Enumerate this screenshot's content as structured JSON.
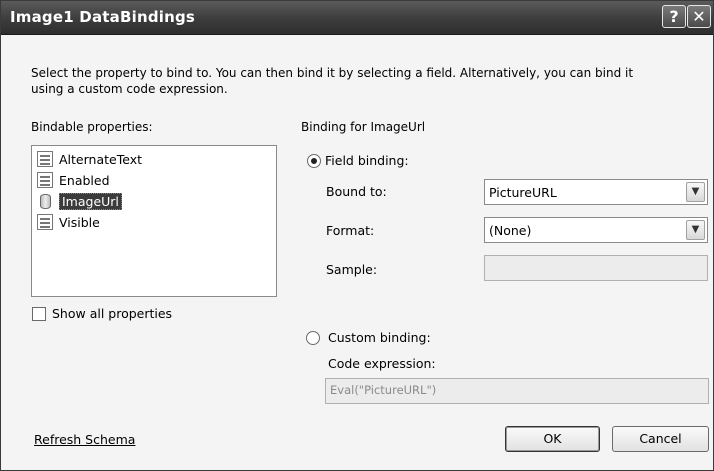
{
  "window": {
    "title": "Image1 DataBindings",
    "help_label": "?",
    "close_label": "✕"
  },
  "description": {
    "line1": "Select the property to bind to. You can then bind it by selecting a field. Alternatively, you can bind it",
    "line2": "using a custom code expression."
  },
  "bindable": {
    "label": "Bindable properties:",
    "items": [
      {
        "label": "AlternateText",
        "icon": "property-icon"
      },
      {
        "label": "Enabled",
        "icon": "property-icon"
      },
      {
        "label": "ImageUrl",
        "icon": "database-icon",
        "selected": true
      },
      {
        "label": "Visible",
        "icon": "property-icon"
      }
    ],
    "show_all_label": "Show all properties",
    "show_all_checked": false
  },
  "binding": {
    "header": "Binding for ImageUrl",
    "field_binding_label": "Field binding:",
    "field_binding_selected": true,
    "bound_to_label": "Bound to:",
    "bound_to_value": "PictureURL",
    "format_label": "Format:",
    "format_value": "(None)",
    "sample_label": "Sample:",
    "sample_value": "",
    "custom_binding_label": "Custom binding:",
    "custom_binding_selected": false,
    "code_expression_label": "Code expression:",
    "code_expression_value": "Eval(\"PictureURL\")"
  },
  "footer": {
    "refresh_label": "Refresh Schema",
    "ok_label": "OK",
    "cancel_label": "Cancel"
  }
}
